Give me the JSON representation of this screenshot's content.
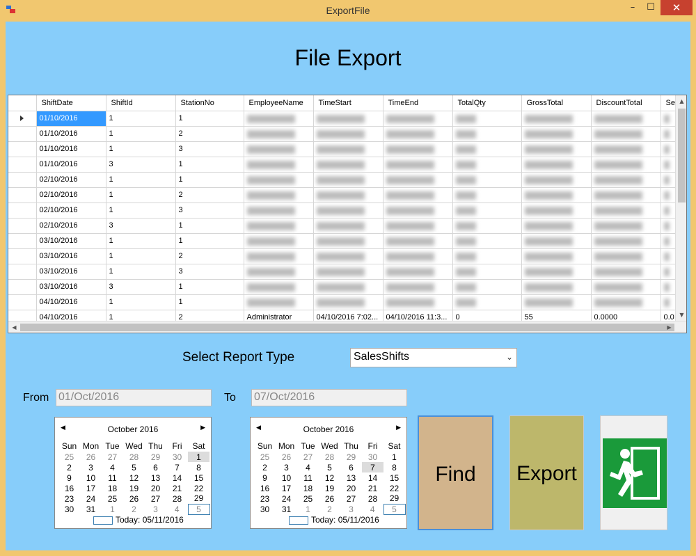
{
  "window": {
    "title": "ExportFile",
    "min": "–",
    "max": "☐",
    "close": "✕"
  },
  "page": {
    "title": "File Export"
  },
  "grid": {
    "columns": [
      "ShiftDate",
      "ShiftId",
      "StationNo",
      "EmployeeName",
      "TimeStart",
      "TimeEnd",
      "TotalQty",
      "GrossTotal",
      "DiscountTotal",
      "Se"
    ],
    "rows": [
      [
        "01/10/2016",
        "1",
        "1"
      ],
      [
        "01/10/2016",
        "1",
        "2"
      ],
      [
        "01/10/2016",
        "1",
        "3"
      ],
      [
        "01/10/2016",
        "3",
        "1"
      ],
      [
        "02/10/2016",
        "1",
        "1"
      ],
      [
        "02/10/2016",
        "1",
        "2"
      ],
      [
        "02/10/2016",
        "1",
        "3"
      ],
      [
        "02/10/2016",
        "3",
        "1"
      ],
      [
        "03/10/2016",
        "1",
        "1"
      ],
      [
        "03/10/2016",
        "1",
        "2"
      ],
      [
        "03/10/2016",
        "1",
        "3"
      ],
      [
        "03/10/2016",
        "3",
        "1"
      ],
      [
        "04/10/2016",
        "1",
        "1"
      ],
      [
        "04/10/2016",
        "1",
        "2"
      ]
    ],
    "last_row_partial": [
      "Administrator",
      "04/10/2016 7:02...",
      "04/10/2016 11:3...",
      "0",
      "55",
      "0.0000",
      "0.0"
    ]
  },
  "report": {
    "label": "Select Report Type",
    "value": "SalesShifts"
  },
  "from": {
    "label": "From",
    "value": "01/Oct/2016"
  },
  "to": {
    "label": "To",
    "value": "07/Oct/2016"
  },
  "calendar_from": {
    "month": "October 2016",
    "days_header": [
      "Sun",
      "Mon",
      "Tue",
      "Wed",
      "Thu",
      "Fri",
      "Sat"
    ],
    "weeks": [
      [
        "25",
        "26",
        "27",
        "28",
        "29",
        "30",
        "1"
      ],
      [
        "2",
        "3",
        "4",
        "5",
        "6",
        "7",
        "8"
      ],
      [
        "9",
        "10",
        "11",
        "12",
        "13",
        "14",
        "15"
      ],
      [
        "16",
        "17",
        "18",
        "19",
        "20",
        "21",
        "22"
      ],
      [
        "23",
        "24",
        "25",
        "26",
        "27",
        "28",
        "29"
      ],
      [
        "30",
        "31",
        "1",
        "2",
        "3",
        "4",
        "5"
      ]
    ],
    "today": "Today: 05/11/2016"
  },
  "calendar_to": {
    "month": "October 2016",
    "days_header": [
      "Sun",
      "Mon",
      "Tue",
      "Wed",
      "Thu",
      "Fri",
      "Sat"
    ],
    "weeks": [
      [
        "25",
        "26",
        "27",
        "28",
        "29",
        "30",
        "1"
      ],
      [
        "2",
        "3",
        "4",
        "5",
        "6",
        "7",
        "8"
      ],
      [
        "9",
        "10",
        "11",
        "12",
        "13",
        "14",
        "15"
      ],
      [
        "16",
        "17",
        "18",
        "19",
        "20",
        "21",
        "22"
      ],
      [
        "23",
        "24",
        "25",
        "26",
        "27",
        "28",
        "29"
      ],
      [
        "30",
        "31",
        "1",
        "2",
        "3",
        "4",
        "5"
      ]
    ],
    "today": "Today: 05/11/2016"
  },
  "buttons": {
    "find": "Find",
    "export": "Export",
    "exit_icon": "exit-sign-icon"
  },
  "colors": {
    "client_bg": "#87cdfa",
    "find_bg": "#d2b48c",
    "export_bg": "#bdb76b",
    "exit_green": "#1a9a3a"
  }
}
